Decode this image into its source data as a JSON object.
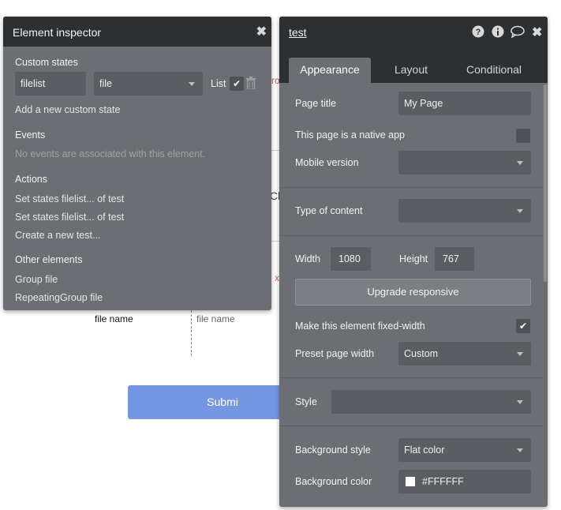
{
  "canvas": {
    "file_name_left": "file name",
    "file_name_right": "file name",
    "submit_label": "Submi",
    "partial_text_1": "ro",
    "partial_text_2": "Cli",
    "x_mark": "x",
    "brand_color": "#7596e3"
  },
  "inspector": {
    "title": "Element inspector",
    "close_icon": "close-icon",
    "custom_states_heading": "Custom states",
    "state_name": "filelist",
    "state_type": "file",
    "list_label": "List",
    "list_checked": true,
    "add_state_link": "Add a new custom state",
    "events_heading": "Events",
    "events_empty": "No events are associated with this element.",
    "actions_heading": "Actions",
    "actions": [
      "Set states filelist... of test",
      "Set states filelist... of test",
      "Create a new test..."
    ],
    "other_heading": "Other elements",
    "other_elements": [
      "Group file",
      "RepeatingGroup file"
    ]
  },
  "editor": {
    "title": "test",
    "tabs": [
      "Appearance",
      "Layout",
      "Conditional"
    ],
    "active_tab": "Appearance",
    "page_title_label": "Page title",
    "page_title_value": "My Page",
    "native_app_label": "This page is a native app",
    "native_app_checked": false,
    "mobile_version_label": "Mobile version",
    "mobile_version_value": "",
    "type_of_content_label": "Type of content",
    "type_of_content_value": "",
    "width_label": "Width",
    "width_value": "1080",
    "height_label": "Height",
    "height_value": "767",
    "upgrade_label": "Upgrade responsive",
    "fixed_width_label": "Make this element fixed-width",
    "fixed_width_checked": true,
    "preset_width_label": "Preset page width",
    "preset_width_value": "Custom",
    "style_label": "Style",
    "style_value": "",
    "bg_style_label": "Background style",
    "bg_style_value": "Flat color",
    "bg_color_label": "Background color",
    "bg_color_value": "#FFFFFF"
  }
}
